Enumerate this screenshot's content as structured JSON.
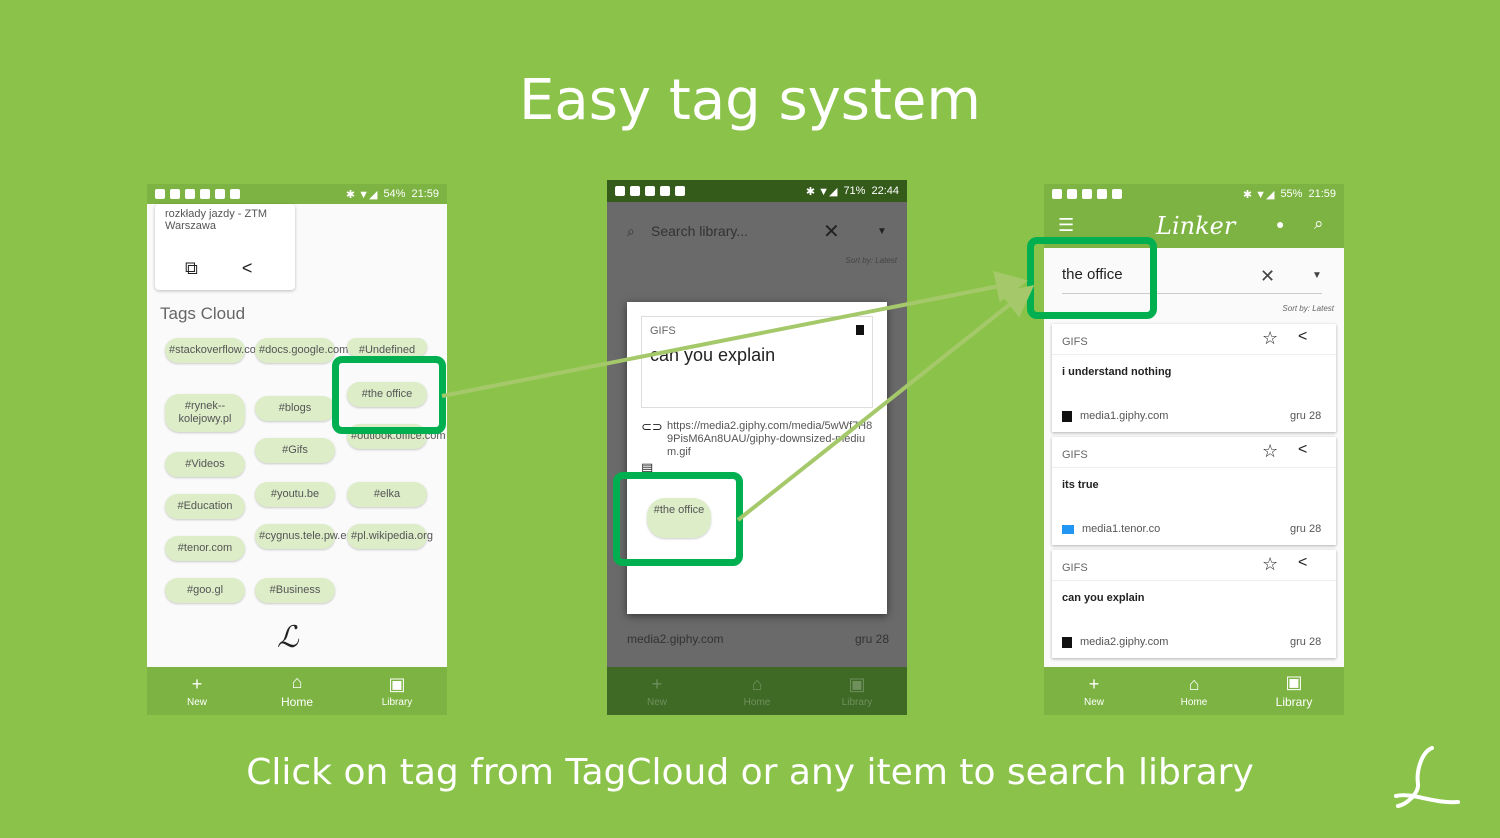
{
  "headline": "Easy tag system",
  "caption": "Click on tag from TagCloud or any item to search library",
  "colors": {
    "background": "#8bc34a",
    "highlight": "#00b050",
    "arrow": "#a5c96a",
    "tag": "#dcedc8"
  },
  "phone1": {
    "status": {
      "battery": "54%",
      "time": "21:59"
    },
    "top_card": {
      "title": "rozkłady jazdy - ZTM Warszawa"
    },
    "tags_title": "Tags Cloud",
    "tags": [
      "#stackoverflow.com",
      "#docs.google.com",
      "#Undefined",
      "#rynek--kolejowy.pl",
      "#blogs",
      "#the office",
      "#outlook.office.com",
      "#Videos",
      "#Gifs",
      "#youtu.be",
      "#elka",
      "#Education",
      "#cygnus.tele.pw.edu.pl",
      "#pl.wikipedia.org",
      "#tenor.com",
      "#goo.gl",
      "#Business"
    ],
    "nav": {
      "new": "New",
      "home": "Home",
      "library": "Library"
    }
  },
  "phone2": {
    "status": {
      "battery": "71%",
      "time": "22:44"
    },
    "search_placeholder": "Search library...",
    "sort": "Sort by: Latest",
    "modal": {
      "category": "GIFS",
      "title": "can you explain",
      "url": "https://media2.giphy.com/media/5wWf7H89PisM6An8UAU/giphy-downsized-medium.gif",
      "tag": "#the office"
    },
    "bottom_row": {
      "source": "media2.giphy.com",
      "date": "gru 28"
    },
    "nav": {
      "new": "New",
      "home": "Home",
      "library": "Library"
    }
  },
  "phone3": {
    "status": {
      "battery": "55%",
      "time": "21:59"
    },
    "brand": "Linker",
    "search_value": "the office",
    "sort": "Sort by: Latest",
    "items": [
      {
        "category": "GIFS",
        "title": "i understand nothing",
        "source": "media1.giphy.com",
        "date": "gru 28"
      },
      {
        "category": "GIFS",
        "title": "its true",
        "source": "media1.tenor.co",
        "date": "gru 28"
      },
      {
        "category": "GIFS",
        "title": "can you explain",
        "source": "media2.giphy.com",
        "date": "gru 28"
      }
    ],
    "nav": {
      "new": "New",
      "home": "Home",
      "library": "Library"
    }
  }
}
